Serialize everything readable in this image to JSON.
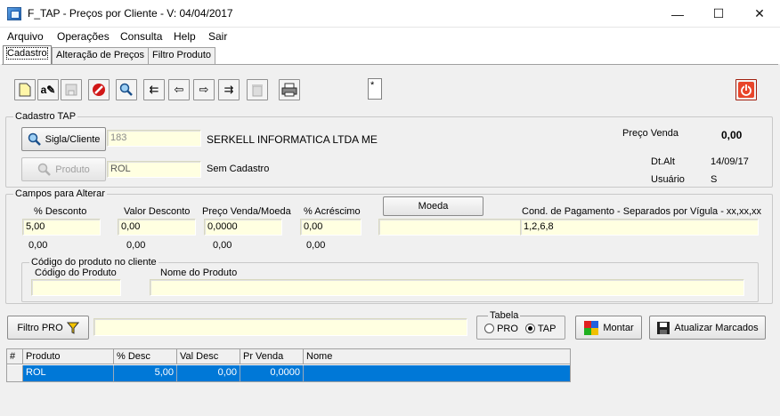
{
  "window": {
    "title": "F_TAP - Preços por Cliente - V: 04/04/2017",
    "min": "—",
    "max": "☐",
    "close": "✕"
  },
  "menu": [
    "Arquivo",
    "Operações",
    "Consulta",
    "Help",
    "Sair"
  ],
  "tabs": [
    "Cadastro",
    "Alteração de Preços",
    "Filtro Produto"
  ],
  "toolbar": {
    "record_marker": "*"
  },
  "cadastro": {
    "title": "Cadastro TAP",
    "sigla_button": "Sigla/Cliente",
    "sigla_value": "183",
    "client_name": "SERKELL INFORMATICA LTDA ME",
    "produto_button": "Produto",
    "produto_value": "ROL",
    "produto_desc": "Sem Cadastro",
    "preco_venda_label": "Preço Venda",
    "preco_venda_value": "0,00",
    "dtalt_label": "Dt.Alt",
    "dtalt_value": "14/09/17",
    "usuario_label": "Usuário",
    "usuario_value": "S"
  },
  "campos": {
    "title": "Campos para Alterar",
    "pct_desc_label": "% Desconto",
    "pct_desc_value": "5,00",
    "pct_desc_calc": "0,00",
    "val_desc_label": "Valor Desconto",
    "val_desc_value": "0,00",
    "val_desc_calc": "0,00",
    "preco_moeda_label": "Preço Venda/Moeda",
    "preco_moeda_value": "0,0000",
    "preco_moeda_calc": "0,00",
    "pct_acresc_label": "% Acréscimo",
    "pct_acresc_value": "0,00",
    "pct_acresc_calc": "0,00",
    "moeda_button": "Moeda",
    "moeda_value": "",
    "cond_label": "Cond. de Pagamento - Separados por Vígula - xx,xx,xx",
    "cond_value": "1,2,6,8",
    "codigo_group": "Código do produto no cliente",
    "codigo_label": "Código do Produto",
    "codigo_value": "",
    "nome_label": "Nome do Produto",
    "nome_value": ""
  },
  "filtro": {
    "button": "Filtro PRO",
    "value": "",
    "tabela_label": "Tabela",
    "opt_pro": "PRO",
    "opt_tap": "TAP",
    "selected": "TAP",
    "montar": "Montar",
    "atualizar": "Atualizar Marcados"
  },
  "grid": {
    "columns": [
      "#",
      "Produto",
      "% Desc",
      "Val Desc",
      "Pr Venda",
      "Nome"
    ],
    "rows": [
      {
        "marker": "",
        "produto": "ROL",
        "desc": "5,00",
        "val": "0,00",
        "venda": "0,0000",
        "nome": ""
      }
    ]
  }
}
